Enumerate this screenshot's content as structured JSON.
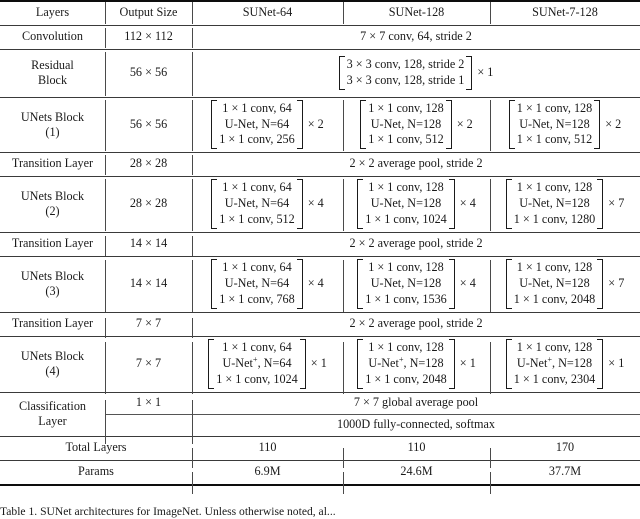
{
  "table": {
    "headers": [
      "Layers",
      "Output Size",
      "SUNet-64",
      "SUNet-128",
      "SUNet-7-128"
    ],
    "rows": {
      "convolution": {
        "layer": "Convolution",
        "output_size": "112 × 112",
        "spec": "7 × 7 conv, 64, stride 2"
      },
      "residual_block": {
        "layer_line1": "Residual",
        "layer_line2": "Block",
        "output_size": "56 × 56",
        "matrix": [
          "3 × 3 conv, 128, stride 2",
          "3 × 3 conv, 128, stride 1"
        ],
        "multiplier": "× 1"
      },
      "unets_block_1": {
        "layer_line1": "UNets Block",
        "layer_line2": "(1)",
        "output_size": "56 × 56",
        "sunet64": {
          "matrix": [
            "1 × 1 conv, 64",
            "U-Net, N=64",
            "1 × 1 conv, 256"
          ],
          "multiplier": "× 2"
        },
        "sunet128": {
          "matrix": [
            "1 × 1 conv, 128",
            "U-Net, N=128",
            "1 × 1 conv, 512"
          ],
          "multiplier": "× 2"
        },
        "sunet7_128": {
          "matrix": [
            "1 × 1 conv, 128",
            "U-Net, N=128",
            "1 × 1 conv, 512"
          ],
          "multiplier": "× 2"
        }
      },
      "transition_1": {
        "layer": "Transition Layer",
        "output_size": "28 × 28",
        "spec": "2 × 2 average pool, stride 2"
      },
      "unets_block_2": {
        "layer_line1": "UNets Block",
        "layer_line2": "(2)",
        "output_size": "28 × 28",
        "sunet64": {
          "matrix": [
            "1 × 1 conv, 64",
            "U-Net, N=64",
            "1 × 1 conv, 512"
          ],
          "multiplier": "× 4"
        },
        "sunet128": {
          "matrix": [
            "1 × 1 conv, 128",
            "U-Net, N=128",
            "1 × 1 conv, 1024"
          ],
          "multiplier": "× 4"
        },
        "sunet7_128": {
          "matrix": [
            "1 × 1 conv, 128",
            "U-Net, N=128",
            "1 × 1 conv, 1280"
          ],
          "multiplier": "× 7"
        }
      },
      "transition_2": {
        "layer": "Transition Layer",
        "output_size": "14 × 14",
        "spec": "2 × 2 average pool, stride 2"
      },
      "unets_block_3": {
        "layer_line1": "UNets Block",
        "layer_line2": "(3)",
        "output_size": "14 × 14",
        "sunet64": {
          "matrix": [
            "1 × 1 conv, 64",
            "U-Net, N=64",
            "1 × 1 conv, 768"
          ],
          "multiplier": "× 4"
        },
        "sunet128": {
          "matrix": [
            "1 × 1 conv, 128",
            "U-Net, N=128",
            "1 × 1 conv, 1536"
          ],
          "multiplier": "× 4"
        },
        "sunet7_128": {
          "matrix": [
            "1 × 1 conv, 128",
            "U-Net, N=128",
            "1 × 1 conv, 2048"
          ],
          "multiplier": "× 7"
        }
      },
      "transition_3": {
        "layer": "Transition Layer",
        "output_size": "7 × 7",
        "spec": "2 × 2 average pool, stride 2"
      },
      "unets_block_4": {
        "layer_line1": "UNets Block",
        "layer_line2": "(4)",
        "output_size": "7 × 7",
        "sunet64": {
          "row1": "1 × 1 conv, 64",
          "row2_pre": "U-Net",
          "row2_sup": "+",
          "row2_post": ", N=64",
          "row3": "1 × 1 conv, 1024",
          "multiplier": "× 1"
        },
        "sunet128": {
          "row1": "1 × 1 conv, 128",
          "row2_pre": "U-Net",
          "row2_sup": "+",
          "row2_post": ", N=128",
          "row3": "1 × 1 conv, 2048",
          "multiplier": "× 1"
        },
        "sunet7_128": {
          "row1": "1 × 1 conv, 128",
          "row2_pre": "U-Net",
          "row2_sup": "+",
          "row2_post": ", N=128",
          "row3": "1 × 1 conv, 2304",
          "multiplier": "× 1"
        }
      },
      "classification": {
        "layer_line1": "Classification",
        "layer_line2": "Layer",
        "output_size": "1 × 1",
        "spec_line1": "7 × 7 global average pool",
        "spec_line2": "1000D fully-connected, softmax"
      },
      "total_layers": {
        "label": "Total Layers",
        "sunet64": "110",
        "sunet128": "110",
        "sunet7_128": "170"
      },
      "params": {
        "label": "Params",
        "sunet64": "6.9M",
        "sunet128": "24.6M",
        "sunet7_128": "37.7M"
      }
    }
  },
  "caption": "Table 1. SUNet architectures for ImageNet. Unless otherwise noted, al..."
}
